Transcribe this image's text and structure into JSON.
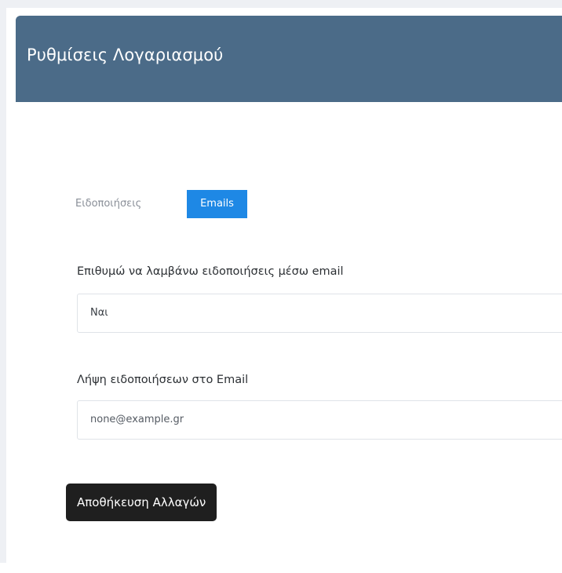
{
  "header": {
    "title": "Ρυθμίσεις Λογαριασμού"
  },
  "tabs": [
    {
      "label": "Ειδοποιήσεις",
      "active": false
    },
    {
      "label": "Emails",
      "active": true
    }
  ],
  "form": {
    "email_notifications": {
      "label": "Επιθυμώ να λαμβάνω ειδοποιήσεις μέσω email",
      "value": "Ναι"
    },
    "notification_email": {
      "label": "Λήψη ειδοποιήσεων στο Email",
      "value": "none@example.gr"
    },
    "save_label": "Αποθήκευση Αλλαγών"
  },
  "colors": {
    "header_bg": "#4b6b88",
    "active_tab": "#1e88e5",
    "save_button": "#1f1f1f"
  }
}
